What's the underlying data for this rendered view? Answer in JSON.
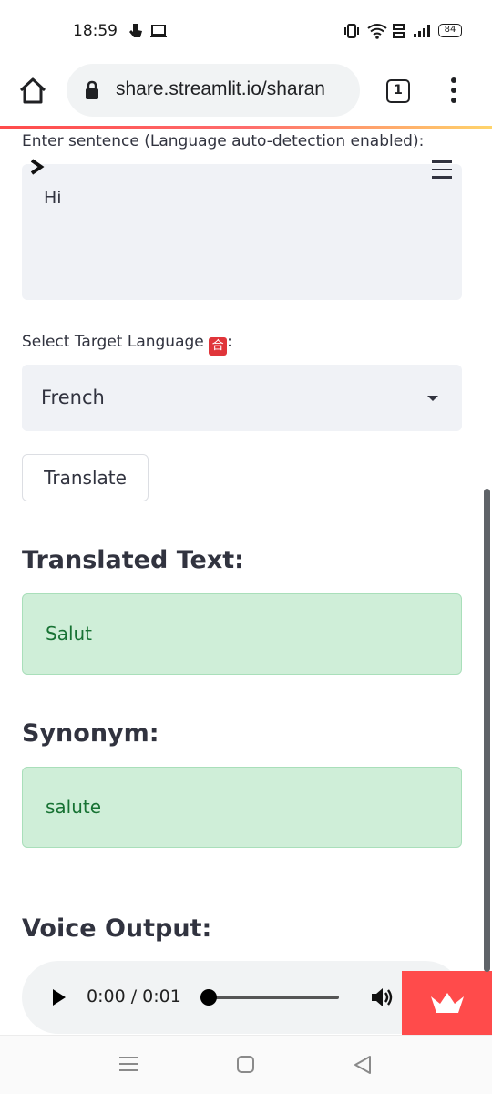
{
  "status_bar": {
    "time": "18:59",
    "battery": "84",
    "icons": [
      "touch-icon",
      "cast-icon",
      "vibrate-icon",
      "wifi-icon",
      "volte-icon",
      "signal-icon",
      "battery-icon"
    ]
  },
  "browser": {
    "url": "share.streamlit.io/sharan",
    "tab_count": "1"
  },
  "form": {
    "sentence_label": "Enter sentence (Language auto-detection enabled):",
    "sentence_value": "Hi",
    "target_label": "Select Target Language",
    "target_badge": "合",
    "target_colon": ":",
    "target_value": "French",
    "translate_button": "Translate"
  },
  "results": {
    "translated_heading": "Translated Text:",
    "translated_value": "Salut",
    "synonym_heading": "Synonym:",
    "synonym_value": "salute",
    "voice_heading": "Voice Output:"
  },
  "audio": {
    "time": "0:00 / 0:01",
    "progress_fraction": 0
  },
  "colors": {
    "accent": "#ff4b4b",
    "success_bg": "#cfeed8",
    "success_text": "#177233",
    "input_bg": "#f0f2f6"
  }
}
